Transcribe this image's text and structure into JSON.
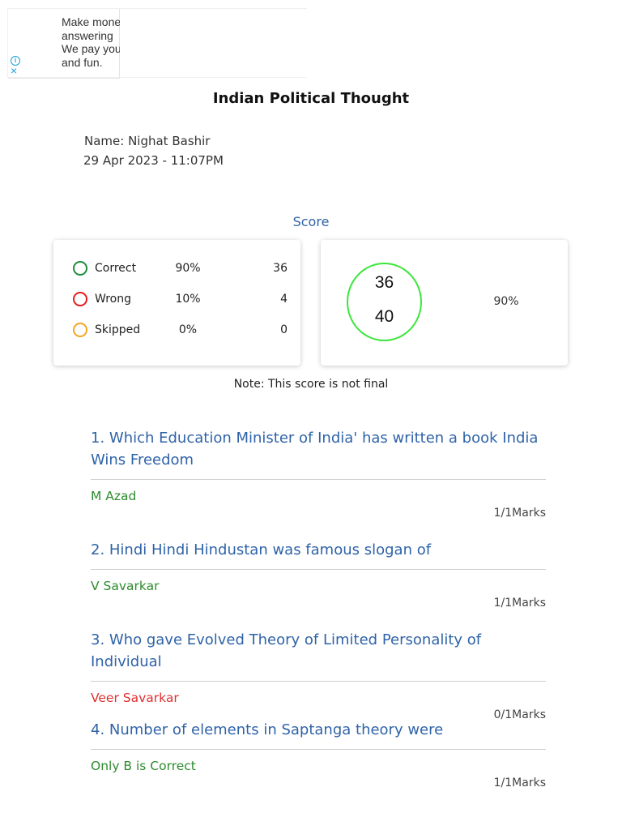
{
  "ad": {
    "lines": [
      "Make money",
      "answering",
      "We pay you",
      "and fun."
    ],
    "info_glyph": "i",
    "close_glyph": "×",
    "accent_color": "#1a9fd9"
  },
  "page": {
    "title": "Indian Political Thought",
    "name_line": "Name: Nighat Bashir",
    "date_line": "29 Apr 2023 - 11:07PM"
  },
  "score": {
    "heading": "Score",
    "stats": [
      {
        "label": "Correct",
        "percent": "90%",
        "count": "36",
        "color": "#1a8f3a"
      },
      {
        "label": "Wrong",
        "percent": "10%",
        "count": "4",
        "color": "#e81c1c"
      },
      {
        "label": "Skipped",
        "percent": "0%",
        "count": "0",
        "color": "#f5a623"
      }
    ],
    "obtained": "36",
    "total": "40",
    "percent": "90%",
    "ring_color": "#3be63b",
    "note": "Note: This score is not final"
  },
  "questions": [
    {
      "text": "1. Which Education Minister of India' has written a book India Wins Freedom",
      "answer": "M Azad",
      "status": "correct",
      "marks": "1/1Marks"
    },
    {
      "text": "2. Hindi Hindi Hindustan was famous slogan of",
      "answer": "V Savarkar",
      "status": "correct",
      "marks": "1/1Marks"
    },
    {
      "text": "3. Who gave Evolved Theory of Limited Personality of Individual",
      "answer": "Veer Savarkar",
      "status": "wrong",
      "marks": "0/1Marks"
    },
    {
      "text": "4. Number of elements in Saptanga theory were",
      "answer": "Only B is Correct",
      "status": "correct",
      "marks": "1/1Marks"
    }
  ]
}
